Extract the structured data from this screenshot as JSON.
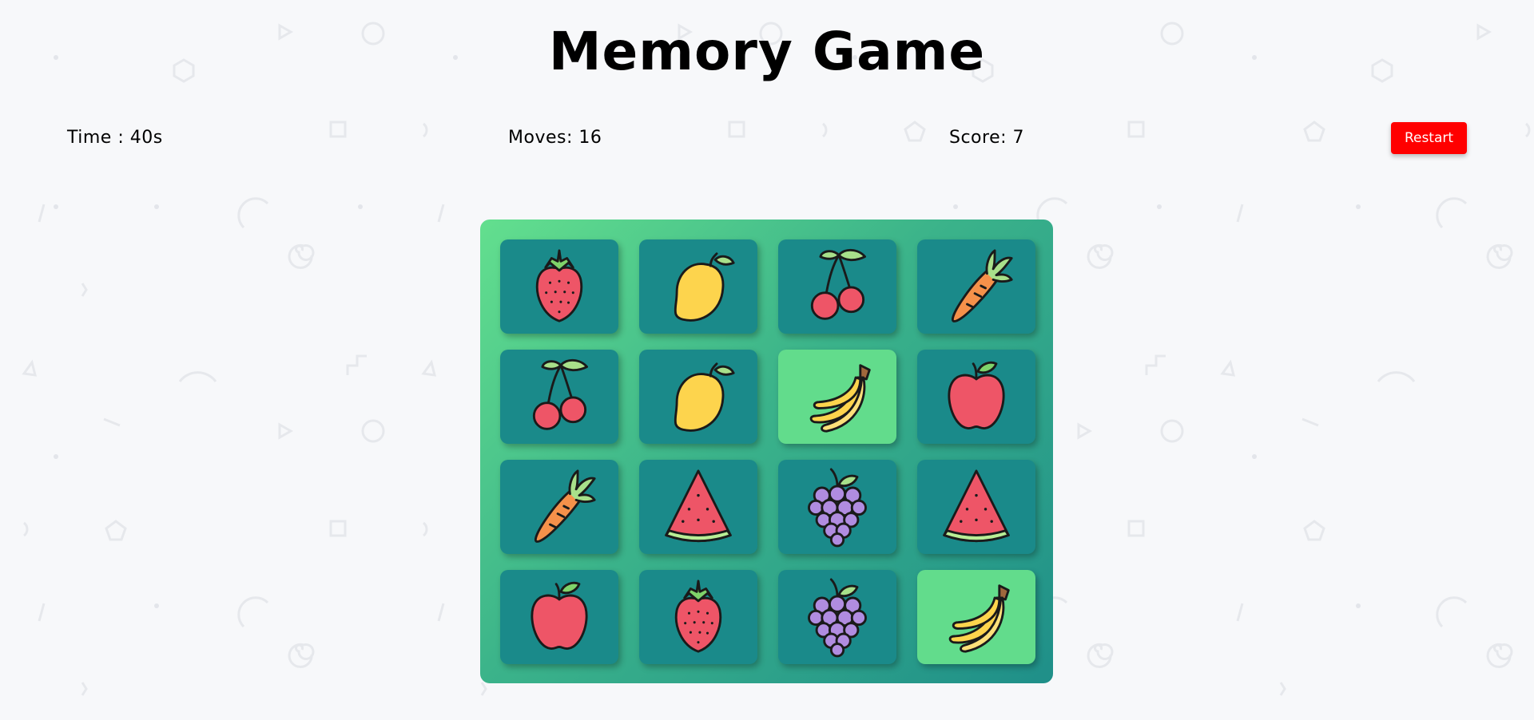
{
  "title": "Memory Game",
  "stats": {
    "time": "Time : 40s",
    "moves": "Moves: 16",
    "score": "Score: 7"
  },
  "restart_label": "Restart",
  "colors": {
    "background": "#f7f8fa",
    "board_start": "#63df8e",
    "board_end": "#1f8f89",
    "card_face": "#1a8a8a",
    "card_matched": "#62dc8c",
    "restart": "#ff0000"
  },
  "grid": {
    "columns": 4,
    "rows": 4,
    "cards": [
      {
        "fruit": "strawberry",
        "matched": false
      },
      {
        "fruit": "mango",
        "matched": false
      },
      {
        "fruit": "cherry",
        "matched": false
      },
      {
        "fruit": "carrot",
        "matched": false
      },
      {
        "fruit": "cherry",
        "matched": false
      },
      {
        "fruit": "mango",
        "matched": false
      },
      {
        "fruit": "banana",
        "matched": true
      },
      {
        "fruit": "apple",
        "matched": false
      },
      {
        "fruit": "carrot",
        "matched": false
      },
      {
        "fruit": "watermelon",
        "matched": false
      },
      {
        "fruit": "grapes",
        "matched": false
      },
      {
        "fruit": "watermelon",
        "matched": false
      },
      {
        "fruit": "apple",
        "matched": false
      },
      {
        "fruit": "strawberry",
        "matched": false
      },
      {
        "fruit": "grapes",
        "matched": false
      },
      {
        "fruit": "banana",
        "matched": true
      }
    ]
  }
}
